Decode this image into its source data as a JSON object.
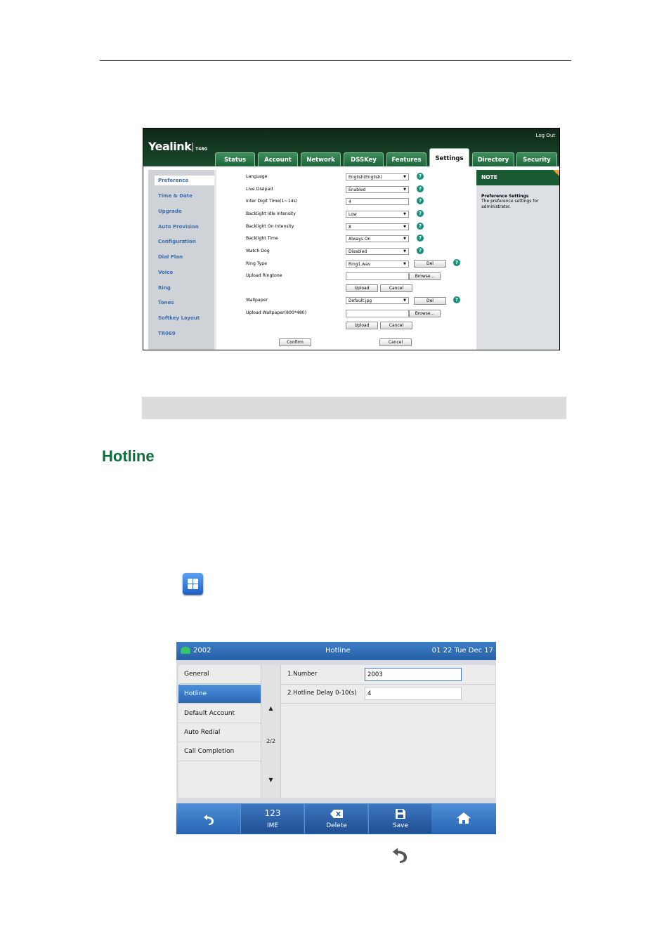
{
  "web": {
    "logo": "Yealink",
    "model": "T48G",
    "logout": "Log Out",
    "tabs": [
      "Status",
      "Account",
      "Network",
      "DSSKey",
      "Features",
      "Settings",
      "Directory",
      "Security"
    ],
    "active_tab": "Settings",
    "nav": [
      "Preference",
      "Time & Date",
      "Upgrade",
      "Auto Provision",
      "Configuration",
      "Dial Plan",
      "Voice",
      "Ring",
      "Tones",
      "Softkey Layout",
      "TR069"
    ],
    "fields": [
      {
        "label": "Language",
        "value": "English(English)",
        "type": "select"
      },
      {
        "label": "Live Dialpad",
        "value": "Enabled",
        "type": "select"
      },
      {
        "label": "Inter Digit Time(1~14s)",
        "value": "4",
        "type": "text"
      },
      {
        "label": "Backlight Idle Intensity",
        "value": "Low",
        "type": "select"
      },
      {
        "label": "Backlight On Intensity",
        "value": "8",
        "type": "select"
      },
      {
        "label": "Backlight Time",
        "value": "Always On",
        "type": "select"
      },
      {
        "label": "Watch Dog",
        "value": "Disabled",
        "type": "select"
      },
      {
        "label": "Ring Type",
        "value": "Ring1.wav",
        "type": "select"
      }
    ],
    "upload_ringtone_label": "Upload Ringtone",
    "wallpaper_label": "Wallpaper",
    "wallpaper_value": "Default.jpg",
    "upload_wallpaper_label": "Upload Wallpaper(800*480)",
    "browse_label": "Browse...",
    "del_label": "Del",
    "upload_label": "Upload",
    "cancel_label": "Cancel",
    "confirm_label": "Confirm",
    "help_glyph": "?",
    "note_header": "NOTE",
    "note_title": "Preference Settings",
    "note_text": "The preference settings for administrator."
  },
  "heading": "Hotline",
  "phone": {
    "line": "2002",
    "title": "Hotline",
    "datetime": "01 22 Tue Dec 17",
    "menu": [
      "General",
      "Hotline",
      "Default Account",
      "Auto Redial",
      "Call Completion"
    ],
    "selected_menu": "Hotline",
    "page": "2/2",
    "up_arrow": "▲",
    "down_arrow": "▼",
    "fields": [
      {
        "label": "1.Number",
        "value": "2003"
      },
      {
        "label": "2.Hotline Delay 0-10(s)",
        "value": "4"
      }
    ],
    "softkeys": [
      {
        "top": "123",
        "label": "IME"
      },
      {
        "top": "⌫",
        "label": "Delete"
      },
      {
        "top": "💾",
        "label": "Save"
      }
    ],
    "back_icon": "back-icon",
    "home_icon": "home-icon"
  },
  "colors": {
    "heading": "#0b6d3c",
    "web_header": "#1a4a2c",
    "phone_bar": "#2e6bb5"
  }
}
